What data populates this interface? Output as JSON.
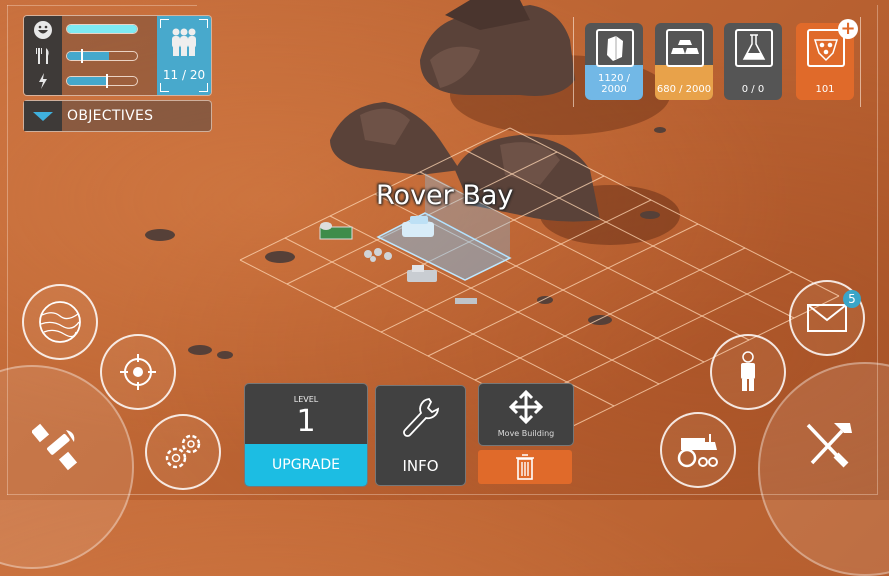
{
  "status": {
    "happiness": {
      "icon": "smiley-icon",
      "level": 1.0,
      "color": "#7eeaf2"
    },
    "food": {
      "icon": "fork-knife-icon",
      "level": 0.6,
      "marker": 0.2,
      "color": "#45a8cc"
    },
    "power": {
      "icon": "lightning-icon",
      "level": 0.55,
      "marker": 0.55,
      "color": "#45a8cc"
    },
    "population": {
      "icon": "people-icon",
      "value": "11 / 20",
      "color": "#48a9cc"
    }
  },
  "objectives": {
    "label": "OBJECTIVES"
  },
  "resources": [
    {
      "name": "crystal",
      "icon": "crystal-icon",
      "value": "1120 / 2000",
      "fill": 0.56,
      "color": "#72b8e6"
    },
    {
      "name": "metal",
      "icon": "metal-bars-icon",
      "value": "680 / 2000",
      "fill": 0.34,
      "color": "#e8a24a"
    },
    {
      "name": "research",
      "icon": "flask-icon",
      "value": "0 / 0",
      "fill": 0,
      "color": "#5a5a5a"
    },
    {
      "name": "premium",
      "icon": "premium-token-icon",
      "value": "101",
      "color": "#e06a2a",
      "action": "plus-icon"
    }
  ],
  "selected_building": {
    "name": "Rover Bay"
  },
  "actions": {
    "level_label": "LEVEL",
    "level_value": "1",
    "upgrade_label": "UPGRADE",
    "info_label": "INFO",
    "move_label": "Move Building"
  },
  "left_buttons": [
    "planet-icon",
    "target-icon",
    "satellite-icon",
    "gears-icon"
  ],
  "right_buttons": [
    "mail-icon",
    "astronaut-icon",
    "rover-icon",
    "build-tools-icon"
  ],
  "mail_badge": "5"
}
